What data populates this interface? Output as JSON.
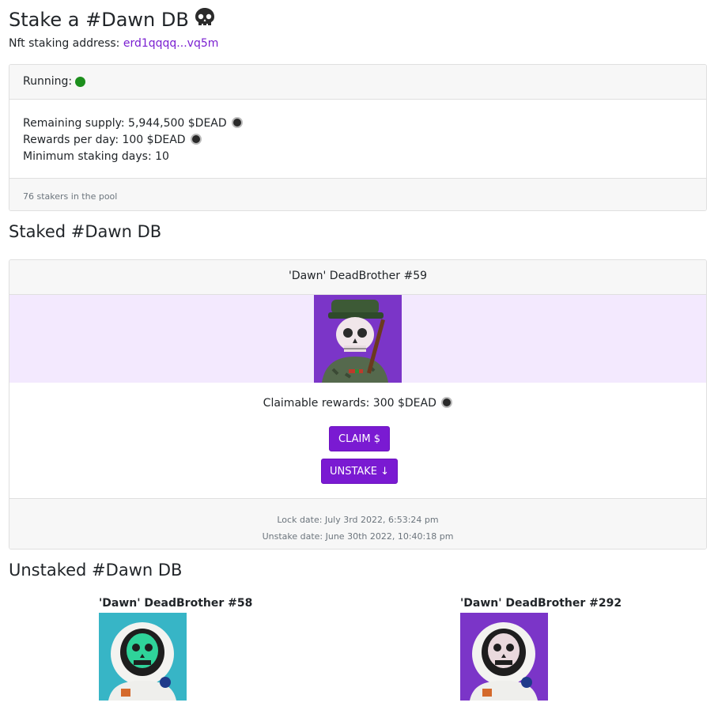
{
  "header": {
    "title": "Stake a #Dawn DB",
    "title_icon": "skull-icon",
    "address_label": "Nft staking address: ",
    "address_value": "erd1qqqq...vq5m"
  },
  "pool": {
    "running_label": "Running:",
    "running_status_color": "#1d8f1d",
    "remaining_supply": "Remaining supply: 5,944,500 $DEAD",
    "rewards_per_day": "Rewards per day: 100 $DEAD",
    "min_staking_days": "Minimum staking days: 10",
    "stakers": "76 stakers in the pool"
  },
  "staked": {
    "title": "Staked #Dawn DB",
    "item_name": "'Dawn' DeadBrother #59",
    "claimable": "Claimable rewards: 300 $DEAD",
    "claim_label": "CLAIM $",
    "unstake_label": "UNSTAKE ↓",
    "lock_date": "Lock date: July 3rd 2022, 6:53:24 pm",
    "unstake_date": "Unstake date: June 30th 2022, 10:40:18 pm"
  },
  "unstaked": {
    "title": "Unstaked #Dawn DB",
    "items": [
      {
        "name": "'Dawn' DeadBrother #58"
      },
      {
        "name": "'Dawn' DeadBrother #292"
      }
    ]
  },
  "colors": {
    "accent": "#7a1ad2",
    "link": "#7a1fd1",
    "nft_strip_bg": "#f3e9fe"
  }
}
